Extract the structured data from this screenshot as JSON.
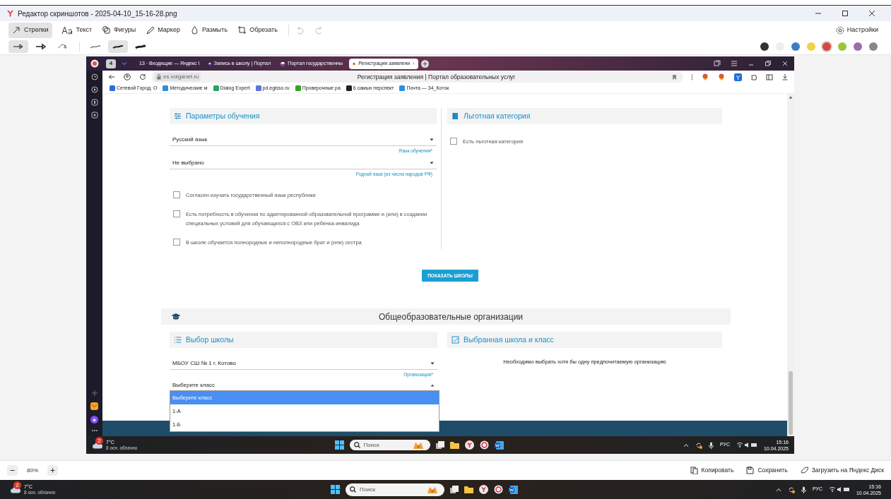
{
  "editor": {
    "title": "Редактор скриншотов - 2025-04-10_15-16-28.png",
    "tools": [
      {
        "kind": "arrow",
        "label": "Стрелки",
        "selected": true
      },
      {
        "kind": "text",
        "label": "Текст",
        "selected": false
      },
      {
        "kind": "shapes",
        "label": "Фигуры",
        "selected": false
      },
      {
        "kind": "marker",
        "label": "Маркер",
        "selected": false
      },
      {
        "kind": "blur",
        "label": "Размыть",
        "selected": false
      },
      {
        "kind": "crop",
        "label": "Обрезать",
        "selected": false
      }
    ],
    "settings": "Настройки",
    "arrow_styles": [
      {
        "selected": true
      },
      {
        "selected": false
      },
      {
        "selected": false
      }
    ],
    "line_widths": [
      {
        "selected": false
      },
      {
        "selected": true
      },
      {
        "selected": false
      }
    ],
    "colors": [
      {
        "color": "#333333",
        "selected": false
      },
      {
        "color": "#eeeeee",
        "selected": false
      },
      {
        "color": "#3c7dc4",
        "selected": false
      },
      {
        "color": "#f5d04c",
        "selected": false
      },
      {
        "color": "#d9473b",
        "selected": true
      },
      {
        "color": "#9ac63a",
        "selected": false
      },
      {
        "color": "#9a6db0",
        "selected": false
      },
      {
        "color": "#888888",
        "selected": false
      }
    ],
    "zoom": "80%",
    "actions": [
      "Копировать",
      "Сохранить",
      "Загрузить на Яндекс Диск"
    ]
  },
  "browser": {
    "tab_count": "4",
    "tabs": [
      {
        "label": "13 · Входящие — Яндекс I",
        "selected": false
      },
      {
        "label": "Запись в школу | Портал",
        "selected": false
      },
      {
        "label": "Портал государственны",
        "selected": false
      },
      {
        "label": "Регистрация заявлени",
        "selected": true
      }
    ],
    "url": "es.volganet.ru",
    "page_title": "Регистрация заявления | Портал образовательных услуг",
    "bookmarks": [
      "Сетевой Город. О",
      "Методические м",
      "Dialog Expert",
      "pd.egisso.ru",
      "Проверочные ра",
      "6 самых перспект",
      "Почта — 34_Коток"
    ]
  },
  "page": {
    "study": {
      "title": "Параметры обучения",
      "selects": [
        {
          "value": "Русский язык",
          "hint": "Язык обучения*"
        },
        {
          "value": "Не выбрано",
          "hint": "Родной язык (из числа народов РФ)"
        }
      ],
      "checkboxes": [
        {
          "label": "Согласен изучать государственный язык республики",
          "checked": false
        },
        {
          "label": "Есть потребность в обучении по адаптированной образовательной программе и (или) в создании специальных условий для обучающихся с ОВЗ или ребенка-инвалида",
          "checked": false
        },
        {
          "label": "В школе обучается полнородные и неполнородные брат и (или) сестра",
          "checked": false
        }
      ]
    },
    "benefit": {
      "title": "Льготная категория",
      "checkbox": {
        "label": "Есть льготная категория",
        "checked": false
      }
    },
    "show_button": "ПОКАЗАТЬ ШКОЛЫ",
    "orgs_title": "Общеобразовательные организации",
    "school": {
      "title": "Выбор школы",
      "org_value": "МБОУ СШ № 1 г. Котово",
      "org_hint": "Организация*",
      "class_value": "Выберите класс",
      "expanded": true,
      "options": [
        {
          "label": "Выберите класс",
          "selected": true
        },
        {
          "label": "1-А",
          "selected": false
        },
        {
          "label": "1-Б",
          "selected": false
        }
      ]
    },
    "chosen": {
      "title": "Выбранная школа и класс",
      "message": "Необходимо выбрать хотя бы одну предпочитаемую организацию"
    }
  },
  "inner_taskbar": {
    "badge": "2",
    "temperature": "7°C",
    "weather": "8 осн. облачно",
    "search": "Поиск",
    "lang": "РУС",
    "time": "15:16",
    "date": "10.04.2025"
  },
  "taskbar": {
    "badge": "2",
    "temperature": "7°C",
    "weather": "8 осн. облачно",
    "search": "Поиск",
    "lang": "РУС",
    "time": "15:16",
    "date": "10.04.2025"
  }
}
